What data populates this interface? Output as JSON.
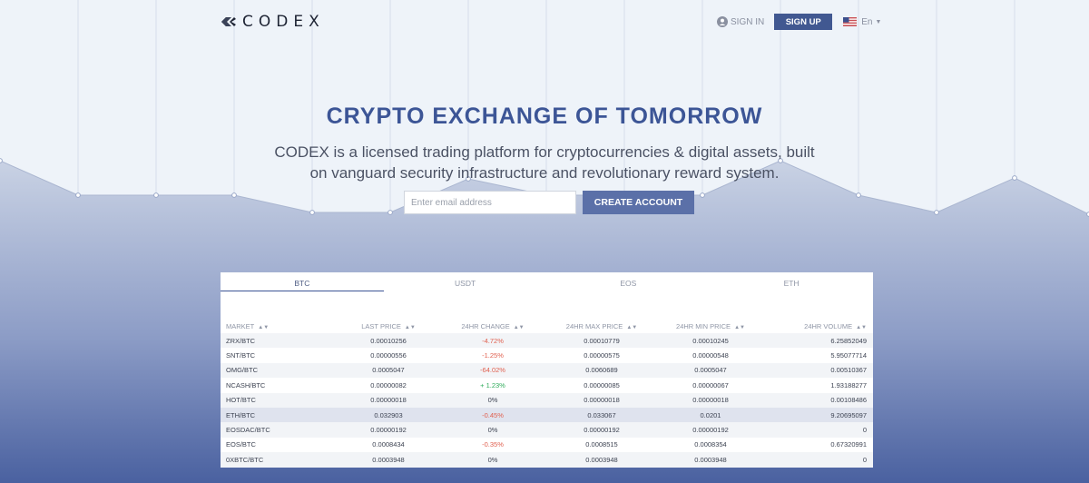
{
  "header": {
    "logo_text": "CODEX",
    "sign_in": "SIGN IN",
    "sign_up": "SIGN UP",
    "language": "En"
  },
  "hero": {
    "title": "CRYPTO EXCHANGE OF TOMORROW",
    "subtitle": "CODEX is a licensed trading platform for cryptocurrencies & digital assets, built on vanguard security infrastructure and revolutionary reward system.",
    "email_placeholder": "Enter email address",
    "cta": "CREATE ACCOUNT"
  },
  "market": {
    "tabs": [
      "BTC",
      "USDT",
      "EOS",
      "ETH"
    ],
    "active_tab": "BTC",
    "columns": [
      "MARKET",
      "LAST PRICE",
      "24HR CHANGE",
      "24HR MAX PRICE",
      "24HR MIN PRICE",
      "24HR VOLUME"
    ],
    "rows": [
      {
        "market": "ZRX/BTC",
        "last": "0.00010256",
        "change": "-4.72%",
        "dir": "neg",
        "max": "0.00010779",
        "min": "0.00010245",
        "volume": "6.25852049"
      },
      {
        "market": "SNT/BTC",
        "last": "0.00000556",
        "change": "-1.25%",
        "dir": "neg",
        "max": "0.00000575",
        "min": "0.00000548",
        "volume": "5.95077714"
      },
      {
        "market": "OMG/BTC",
        "last": "0.0005047",
        "change": "-64.02%",
        "dir": "neg",
        "max": "0.0060689",
        "min": "0.0005047",
        "volume": "0.00510367"
      },
      {
        "market": "NCASH/BTC",
        "last": "0.00000082",
        "change": "+ 1.23%",
        "dir": "pos",
        "max": "0.00000085",
        "min": "0.00000067",
        "volume": "1.93188277"
      },
      {
        "market": "HOT/BTC",
        "last": "0.00000018",
        "change": "0%",
        "dir": "flat",
        "max": "0.00000018",
        "min": "0.00000018",
        "volume": "0.00108486"
      },
      {
        "market": "ETH/BTC",
        "last": "0.032903",
        "change": "-0.45%",
        "dir": "neg",
        "max": "0.033067",
        "min": "0.0201",
        "volume": "9.20695097"
      },
      {
        "market": "EOSDAC/BTC",
        "last": "0.00000192",
        "change": "0%",
        "dir": "flat",
        "max": "0.00000192",
        "min": "0.00000192",
        "volume": "0"
      },
      {
        "market": "EOS/BTC",
        "last": "0.0008434",
        "change": "-0.35%",
        "dir": "neg",
        "max": "0.0008515",
        "min": "0.0008354",
        "volume": "0.67320991"
      },
      {
        "market": "0XBTC/BTC",
        "last": "0.0003948",
        "change": "0%",
        "dir": "flat",
        "max": "0.0003948",
        "min": "0.0003948",
        "volume": "0"
      }
    ],
    "highlighted_row": 5
  },
  "colors": {
    "brand": "#3c5596",
    "button": "#415891",
    "cta": "#5b70a8",
    "negative": "#e0604f",
    "positive": "#2eab5a"
  }
}
